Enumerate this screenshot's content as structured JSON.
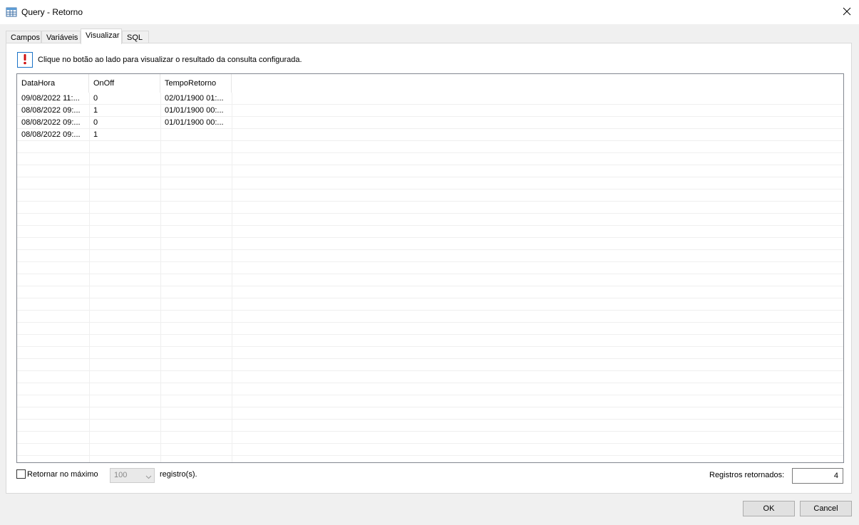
{
  "window": {
    "title": "Query - Retorno",
    "close_icon": "close-icon"
  },
  "tabs": [
    {
      "label": "Campos",
      "active": false
    },
    {
      "label": "Variáveis",
      "active": false
    },
    {
      "label": "Visualizar",
      "active": true
    },
    {
      "label": "SQL",
      "active": false
    }
  ],
  "info": {
    "icon": "alert-icon",
    "message": "Clique no botão ao lado para visualizar o resultado da consulta configurada."
  },
  "grid": {
    "columns": [
      "DataHora",
      "OnOff",
      "TempoRetorno"
    ],
    "rows": [
      [
        "09/08/2022 11:...",
        "0",
        "02/01/1900 01:..."
      ],
      [
        "08/08/2022 09:...",
        "1",
        "01/01/1900 00:..."
      ],
      [
        "08/08/2022 09:...",
        "0",
        "01/01/1900 00:..."
      ],
      [
        "08/08/2022 09:...",
        "1",
        ""
      ]
    ]
  },
  "footer": {
    "max_checkbox_label": "Retornar no máximo",
    "max_checkbox_checked": false,
    "max_value": "100",
    "suffix_label": "registro(s).",
    "returned_label": "Registros retornados:",
    "returned_value": "4"
  },
  "buttons": {
    "ok": "OK",
    "cancel": "Cancel"
  }
}
